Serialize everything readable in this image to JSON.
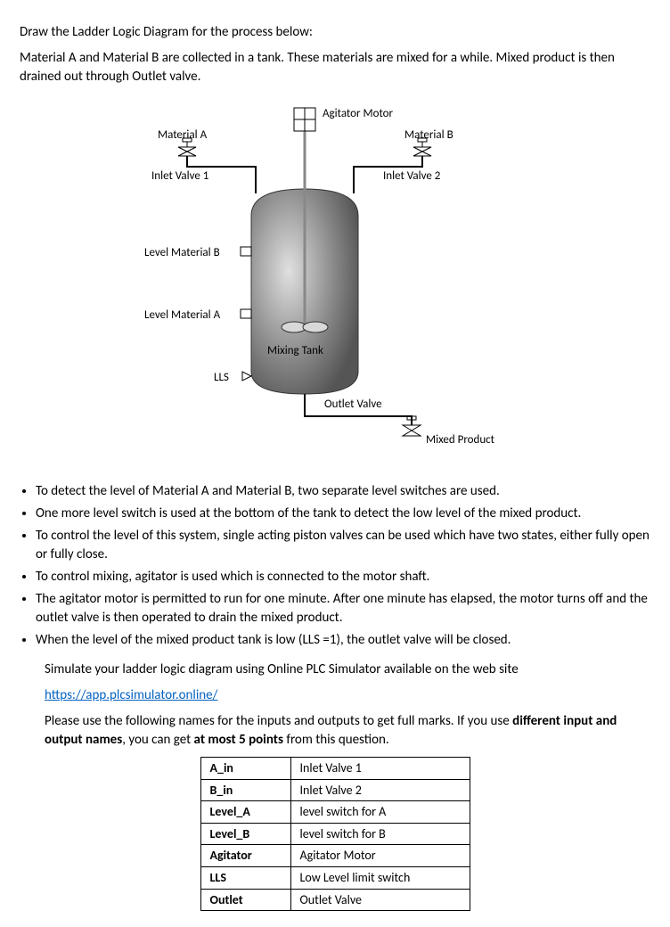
{
  "title": "Draw the Ladder Logic Diagram for the process below:",
  "intro": "Material A and Material B are collected in a tank. These materials are mixed for a while. Mixed product is then drained out through Outlet valve.",
  "diagram": {
    "agitator_motor": "Agitator Motor",
    "material_a": "Material A",
    "material_b": "Material B",
    "inlet_valve_1": "Inlet Valve 1",
    "inlet_valve_2": "Inlet Valve 2",
    "level_material_b": "Level Material B",
    "level_material_a": "Level Material A",
    "mixing_tank": "Mixing Tank",
    "lls": "LLS",
    "outlet_valve": "Outlet Valve",
    "mixed_product": "Mixed Product"
  },
  "bullets": [
    "To detect the level of Material A and Material B, two separate level switches are used.",
    "One more level switch is used at the bottom of the tank to detect the low level of the mixed product.",
    "To control the level of this system, single acting piston valves can be used which have two states, either fully open or fully close.",
    "To control mixing, agitator is used which is connected to the motor shaft.",
    "The agitator motor is permitted to run for one minute. After one minute has elapsed, the motor turns off and the outlet valve is then operated to drain the mixed product.",
    "When the level of the mixed product tank is low (LLS =1), the outlet valve will be closed."
  ],
  "simulate_line": "Simulate your ladder logic diagram using Online PLC Simulator available on the web site",
  "sim_link": "https://app.plcsimulator.online/",
  "naming_intro_1": "Please use the following names for the inputs and outputs to get full marks. If you use ",
  "naming_intro_2": "different input and output names",
  "naming_intro_3": ", you can get ",
  "naming_intro_4": "at most 5 points",
  "naming_intro_5": " from this question.",
  "io_table": [
    {
      "name": "A_in",
      "desc": "Inlet Valve 1"
    },
    {
      "name": "B_in",
      "desc": "Inlet Valve 2"
    },
    {
      "name": "Level_A",
      "desc": "level switch for A"
    },
    {
      "name": "Level_B",
      "desc": "level switch for B"
    },
    {
      "name": "Agitator",
      "desc": "Agitator Motor"
    },
    {
      "name": "LLS",
      "desc": "Low Level limit switch"
    },
    {
      "name": "Outlet",
      "desc": "Outlet Valve"
    }
  ]
}
